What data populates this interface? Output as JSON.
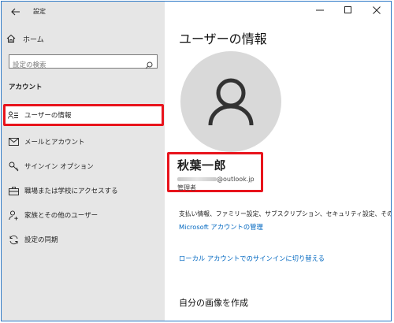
{
  "app": {
    "title": "設定"
  },
  "sidebar": {
    "home_label": "ホーム",
    "search_placeholder": "設定の検索",
    "section_header": "アカウント",
    "items": [
      {
        "label": "ユーザーの情報",
        "icon": "user-info-icon",
        "selected": true
      },
      {
        "label": "メールとアカウント",
        "icon": "mail-icon"
      },
      {
        "label": "サインイン オプション",
        "icon": "key-icon"
      },
      {
        "label": "職場または学校にアクセスする",
        "icon": "briefcase-icon"
      },
      {
        "label": "家族とその他のユーザー",
        "icon": "person-add-icon"
      },
      {
        "label": "設定の同期",
        "icon": "sync-icon"
      }
    ]
  },
  "content": {
    "page_title": "ユーザーの情報",
    "user": {
      "name": "秋葉一郎",
      "email": "@outlook.jp",
      "role": "管理者"
    },
    "info_text": "支払い情報、ファミリー設定、サブスクリプション、セキュリティ設定、その他",
    "manage_link": "Microsoft アカウントの管理",
    "local_link": "ローカル アカウントでのサインインに切り替える",
    "picture_section": "自分の画像を作成"
  },
  "colors": {
    "accent_link": "#0067c0",
    "highlight_border": "#e8141c",
    "sidebar_bg": "#e6e6e6"
  }
}
